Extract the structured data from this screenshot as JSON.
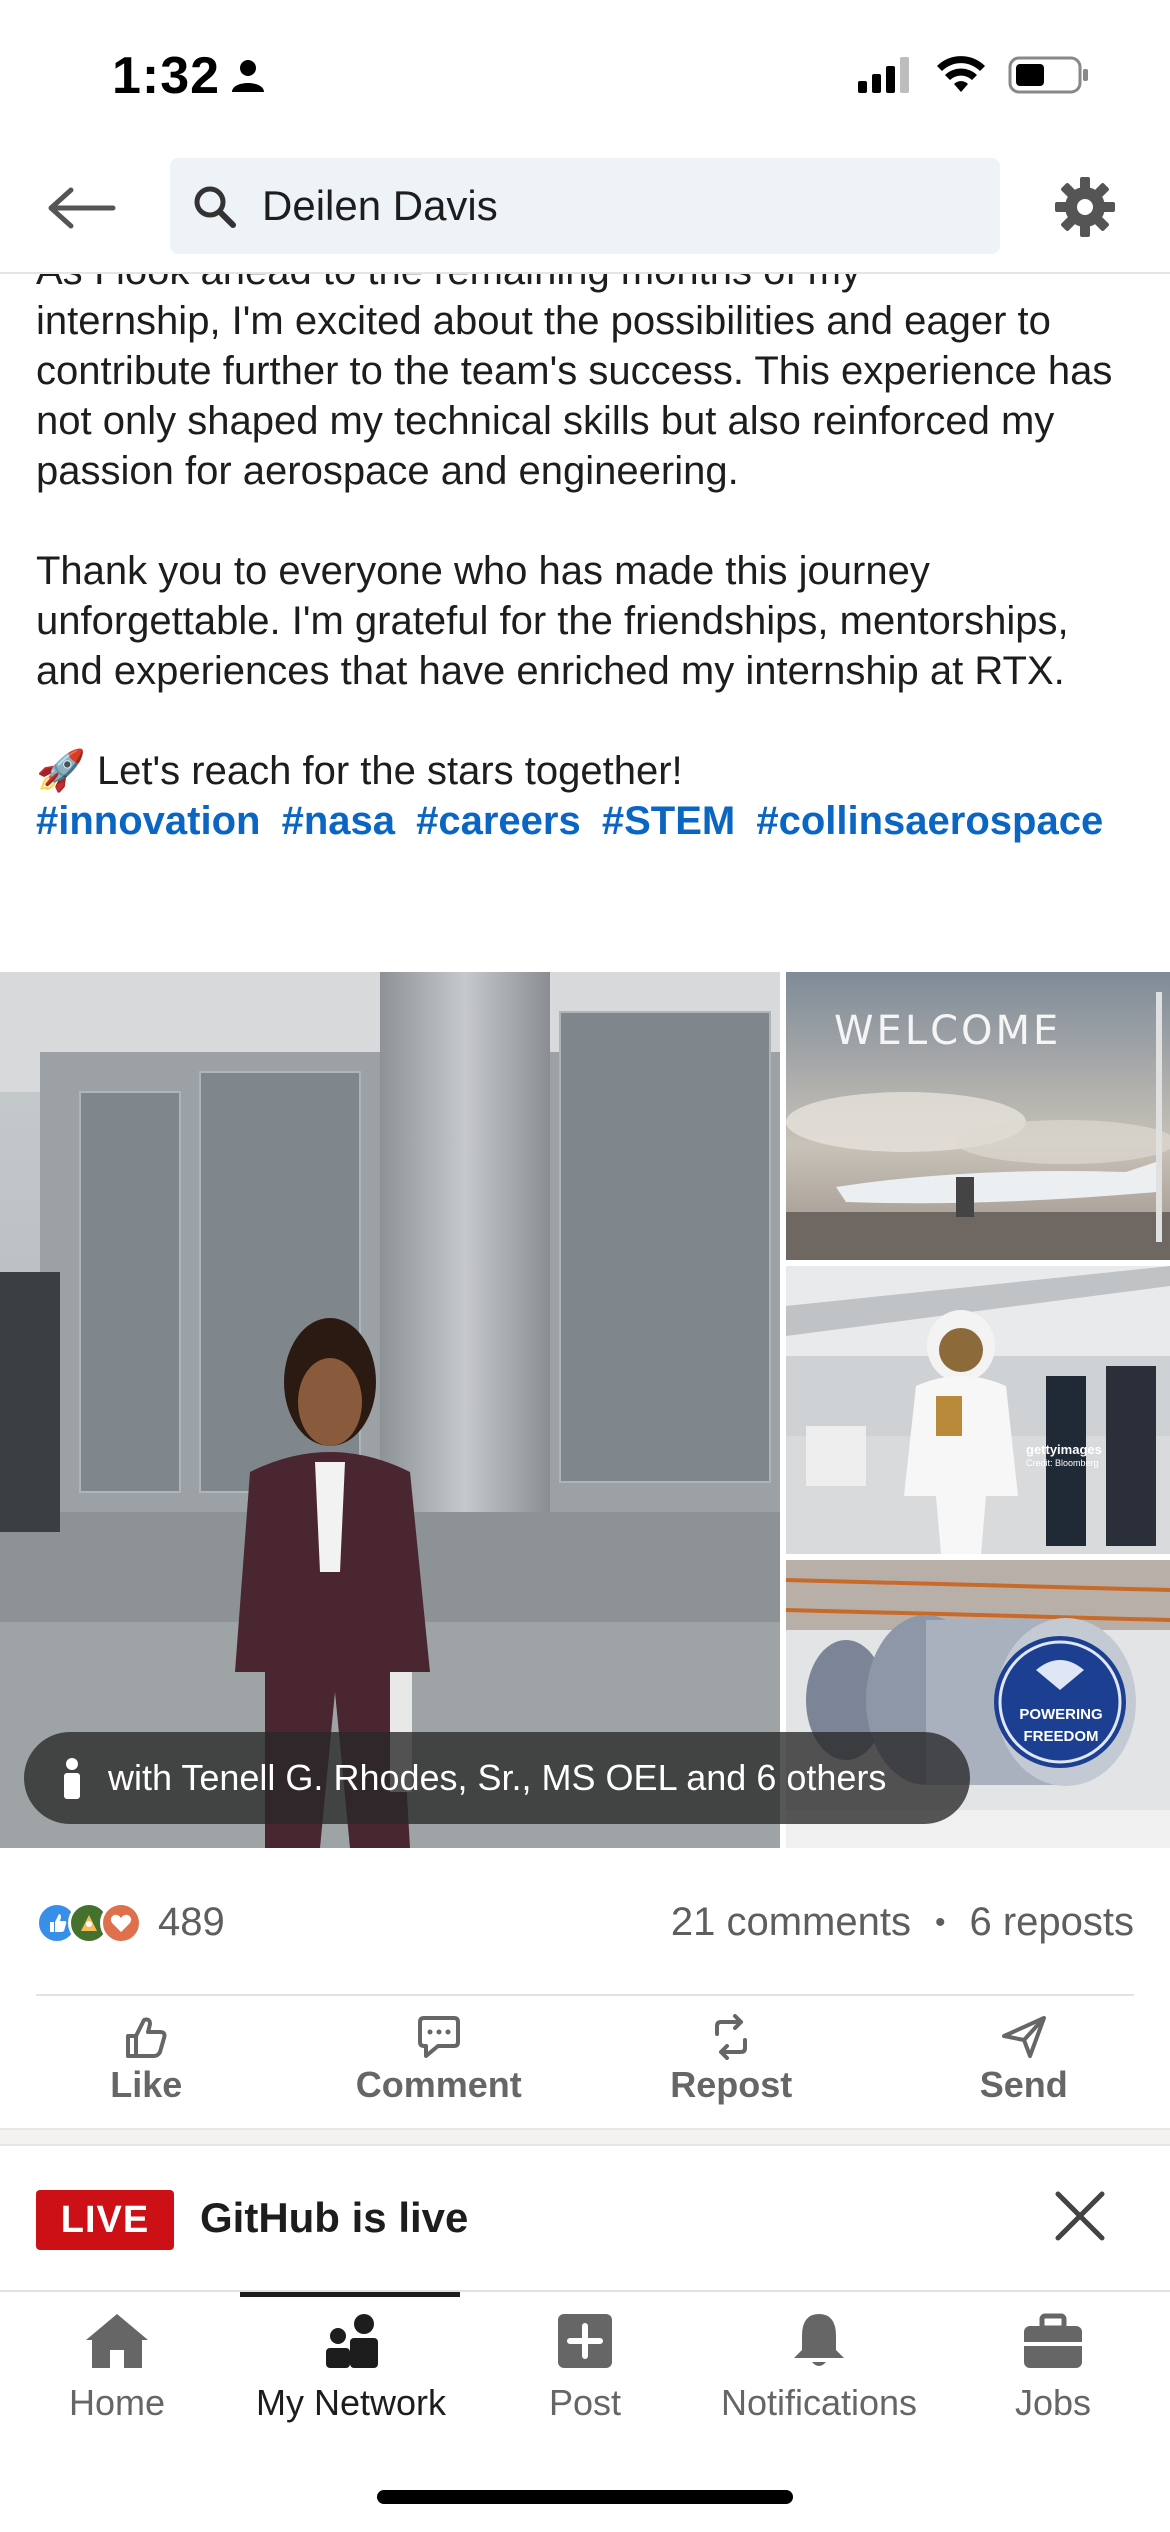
{
  "status_bar": {
    "time": "1:32"
  },
  "search": {
    "query": "Deilen Davis"
  },
  "post": {
    "partial_line": "As I look ahead to the remaining months of my",
    "paragraph1": "internship, I'm excited about the possibilities and eager to contribute further to the team's success. This experience has not only shaped my technical skills but also reinforced my passion for aerospace and engineering.",
    "paragraph2": "Thank you to everyone who has made this journey unforgettable. I'm grateful for the friendships, mentorships, and experiences that have enriched my internship at RTX.",
    "closing_emoji": "🚀",
    "closing_text": "Let's reach for the stars together!",
    "hashtags": [
      "#innovation",
      "#nasa",
      "#careers",
      "#STEM",
      "#collinsaerospace"
    ]
  },
  "photos": {
    "welcome_text": "WELCOME",
    "getty_text": "gettyimages",
    "getty_credit": "Credit: Bloomberg",
    "engine_badge_line1": "POWERING",
    "engine_badge_line2": "FREEDOM",
    "tag_text": "with Tenell G. Rhodes, Sr., MS OEL and 6 others"
  },
  "social": {
    "reaction_count": "489",
    "comments": "21 comments",
    "separator": "•",
    "reposts": "6 reposts"
  },
  "actions": {
    "like": "Like",
    "comment": "Comment",
    "repost": "Repost",
    "send": "Send"
  },
  "live_banner": {
    "badge": "LIVE",
    "title": "GitHub is live"
  },
  "bottom_nav": {
    "home": "Home",
    "my_network": "My Network",
    "post": "Post",
    "notifications": "Notifications",
    "jobs": "Jobs"
  },
  "colors": {
    "link_blue": "#0a66c2",
    "live_red": "#cc1016",
    "search_bg": "#eef3f8"
  }
}
